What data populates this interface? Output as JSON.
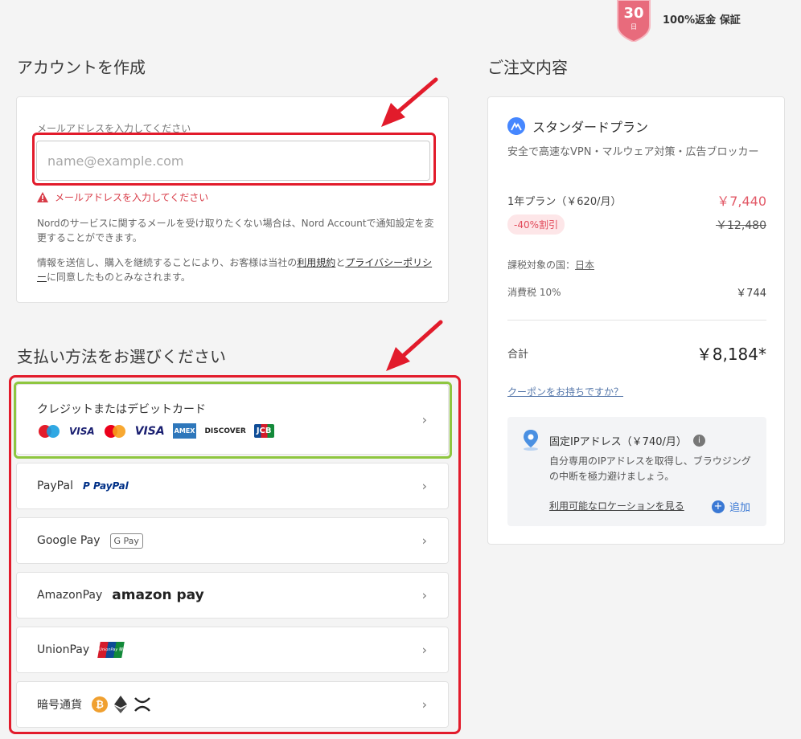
{
  "guarantee": {
    "days": "30",
    "day_unit": "日",
    "text": "100%返金 保証"
  },
  "account": {
    "heading": "アカウントを作成",
    "email_label": "メールアドレスを入力してください",
    "email_placeholder": "name@example.com",
    "email_value": "",
    "error": "メールアドレスを入力してください",
    "note1": "Nordのサービスに関するメールを受け取りたくない場合は、Nord Accountで通知設定を変更することができます。",
    "note2_pre": "情報を送信し、購入を継続することにより、お客様は当社の",
    "terms_link": "利用規約",
    "note2_mid": "と",
    "privacy_link": "プライバシーポリシー",
    "note2_post": "に同意したものとみなされます。"
  },
  "payment": {
    "heading": "支払い方法をお選びください",
    "credit_label": "クレジットまたはデビットカード",
    "card_brands": [
      "maestro",
      "VISA",
      "mastercard",
      "VISA",
      "AMEX",
      "DISCOVER",
      "JCB"
    ],
    "methods": [
      {
        "label": "PayPal",
        "logo": "PayPal"
      },
      {
        "label": "Google Pay",
        "logo": "G Pay"
      },
      {
        "label": "AmazonPay",
        "logo": "amazon pay"
      },
      {
        "label": "UnionPay",
        "logo": "UnionPay 银联"
      },
      {
        "label": "暗号通貨",
        "logo": ""
      }
    ]
  },
  "order": {
    "heading": "ご注文内容",
    "plan_name": "スタンダードプラン",
    "plan_desc": "安全で高速なVPN・マルウェア対策・広告ブロッカー",
    "term_label": "1年プラン（￥620/月）",
    "term_price": "￥7,440",
    "discount": "-40%割引",
    "original_price": "￥12,480",
    "tax_country_label": "課税対象の国：",
    "tax_country": "日本",
    "tax_label": "消費税 10%",
    "tax_value": "￥744",
    "total_label": "合計",
    "total_value": "￥8,184*",
    "coupon": "クーポンをお持ちですか？",
    "ip": {
      "title": "固定IPアドレス（￥740/月）",
      "desc": "自分専用のIPアドレスを取得し、ブラウジングの中断を極力避けましょう。",
      "locations_link": "利用可能なロケーションを見る",
      "add": "追加"
    }
  },
  "colors": {
    "annotation_red": "#e21b2b",
    "annotation_green": "#8ec63f",
    "price_red": "#e25967"
  }
}
